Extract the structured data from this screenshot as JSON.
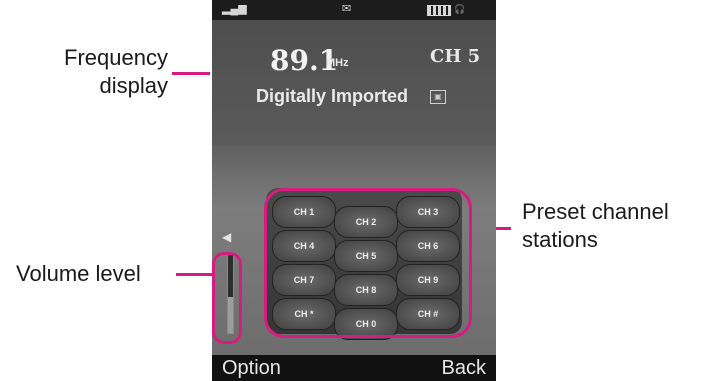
{
  "callouts": {
    "frequency": "Frequency\ndisplay",
    "volume": "Volume level",
    "preset": "Preset channel\nstations"
  },
  "colors": {
    "callout_accent": "#d81b7f",
    "screen_bg": "#5f5f5f",
    "softkey_bg": "#111111"
  },
  "icons": {
    "signal": "signal-icon",
    "message": "message-icon",
    "battery": "battery-icon",
    "headset": "headset-icon",
    "rds": "rds-icon",
    "speaker": "speaker-icon"
  },
  "radio": {
    "frequency": "89.1",
    "unit": "MHz",
    "channel": "CH 5",
    "station": "Digitally Imported"
  },
  "volume": {
    "level": 0.45
  },
  "presets": [
    [
      "CH 1",
      "CH 2",
      "CH 3"
    ],
    [
      "CH 4",
      "CH 5",
      "CH 6"
    ],
    [
      "CH 7",
      "CH 8",
      "CH 9"
    ],
    [
      "CH *",
      "CH 0",
      "CH #"
    ]
  ],
  "softkeys": {
    "left": "Option",
    "right": "Back"
  }
}
